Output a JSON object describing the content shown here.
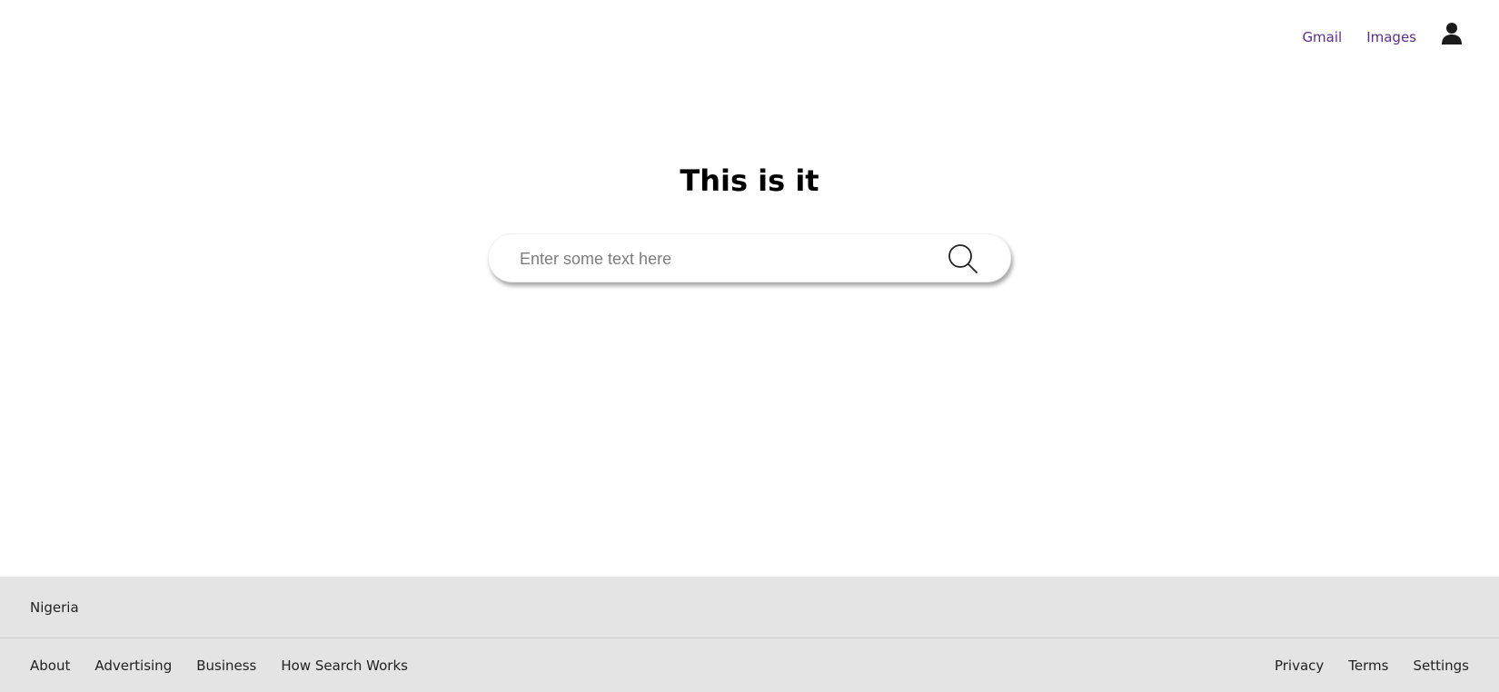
{
  "header": {
    "links": [
      {
        "label": "Gmail"
      },
      {
        "label": "Images"
      }
    ],
    "account_icon": "user-icon"
  },
  "main": {
    "title": "This is it",
    "search": {
      "placeholder": "Enter some text here",
      "value": "",
      "button_icon": "search-icon"
    }
  },
  "footer": {
    "country": "Nigeria",
    "left_links": [
      {
        "label": "About"
      },
      {
        "label": "Advertising"
      },
      {
        "label": "Business"
      },
      {
        "label": "How Search Works"
      }
    ],
    "right_links": [
      {
        "label": "Privacy"
      },
      {
        "label": "Terms"
      },
      {
        "label": "Settings"
      }
    ]
  },
  "colors": {
    "link": "#5a2d91",
    "footer_bg": "#e4e4e4",
    "title": "#000000"
  }
}
